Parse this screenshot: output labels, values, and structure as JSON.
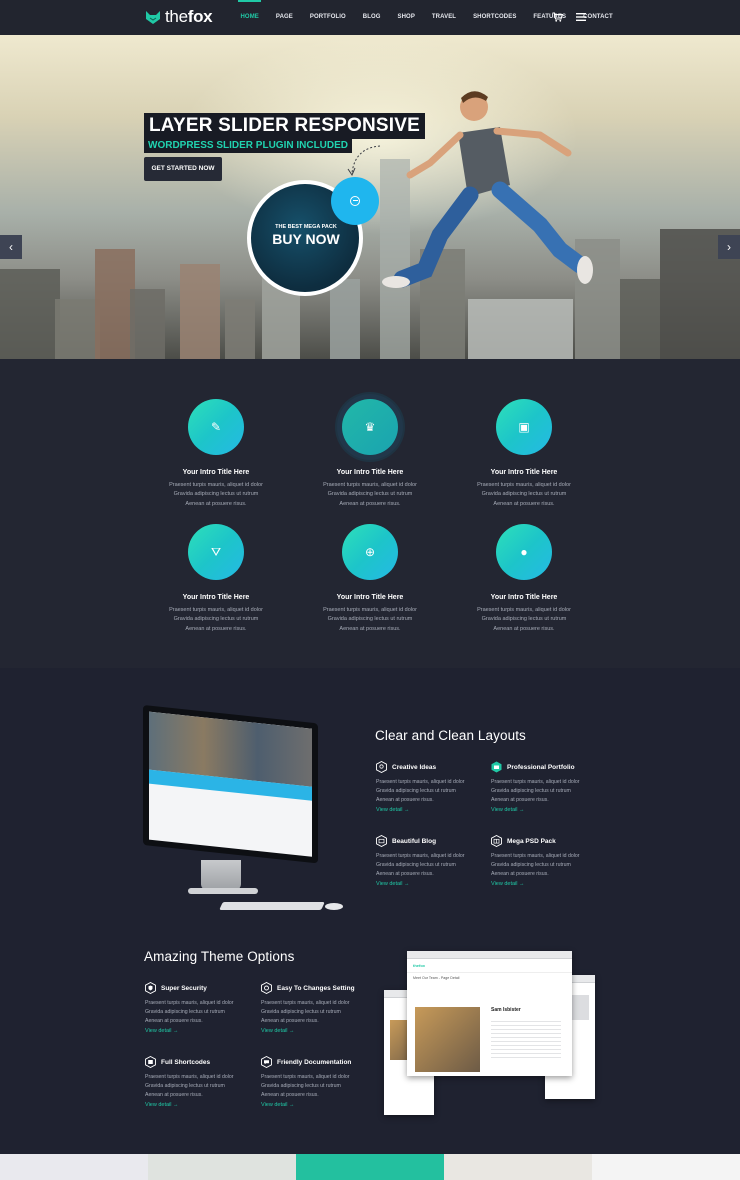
{
  "nav": {
    "brand_prefix": "the",
    "brand_name": "fox",
    "items": [
      {
        "label": "HOME",
        "active": true
      },
      {
        "label": "PAGE"
      },
      {
        "label": "PORTFOLIO"
      },
      {
        "label": "BLOG"
      },
      {
        "label": "SHOP"
      },
      {
        "label": "TRAVEL"
      },
      {
        "label": "SHORTCODES"
      },
      {
        "label": "FEATURES"
      },
      {
        "label": "CONTACT"
      }
    ],
    "icons": [
      "cart-icon",
      "hamburger-menu-icon"
    ],
    "accent_color": "#20c9a6"
  },
  "hero": {
    "title": "LAYER SLIDER RESPONSIVE",
    "subtitle": "WORDPRESS SLIDER PLUGIN INCLUDED",
    "cta_label": "GET STARTED NOW",
    "badge_small": "THE BEST MEGA PACK",
    "badge_big": "BUY NOW",
    "prev_arrow": "‹",
    "next_arrow": "›",
    "slide_count": 4,
    "active_slide": 3
  },
  "features": [
    {
      "icon": "pencil-ruler-icon",
      "title": "Your Intro Title Here",
      "line1": "Praesent turpis mauris, aliquet id dolor",
      "line2": "Gravida adipiscing lectus ut rutrum",
      "line3": "Aenean at posuere risus."
    },
    {
      "icon": "crown-icon",
      "title": "Your Intro Title Here",
      "line1": "Praesent turpis mauris, aliquet id dolor",
      "line2": "Gravida adipiscing lectus ut rutrum",
      "line3": "Aenean at posuere risus."
    },
    {
      "icon": "archive-box-icon",
      "title": "Your Intro Title Here",
      "line1": "Praesent turpis mauris, aliquet id dolor",
      "line2": "Gravida adipiscing lectus ut rutrum",
      "line3": "Aenean at posuere risus."
    },
    {
      "icon": "basket-icon",
      "title": "Your Intro Title Here",
      "line1": "Praesent turpis mauris, aliquet id dolor",
      "line2": "Gravida adipiscing lectus ut rutrum",
      "line3": "Aenean at posuere risus."
    },
    {
      "icon": "lifebuoy-icon",
      "title": "Your Intro Title Here",
      "line1": "Praesent turpis mauris, aliquet id dolor",
      "line2": "Gravida adipiscing lectus ut rutrum",
      "line3": "Aenean at posuere risus."
    },
    {
      "icon": "bomb-icon",
      "title": "Your Intro Title Here",
      "line1": "Praesent turpis mauris, aliquet id dolor",
      "line2": "Gravida adipiscing lectus ut rutrum",
      "line3": "Aenean at posuere risus."
    }
  ],
  "layouts": {
    "title": "Clear and Clean Layouts",
    "items": [
      {
        "icon": "bulb-icon",
        "title": "Creative Ideas",
        "line1": "Praesent turpis mauris, aliquet id dolor",
        "line2": "Gravida adipiscing lectus ut rutrum",
        "line3": "Aenean at posuere risus.",
        "link": "View detail  →"
      },
      {
        "icon": "briefcase-icon",
        "title": "Professional Portfolio",
        "line1": "Praesent turpis mauris, aliquet id dolor",
        "line2": "Gravida adipiscing lectus ut rutrum",
        "line3": "Aenean at posuere risus.",
        "link": "View detail  →"
      },
      {
        "icon": "image-icon",
        "title": "Beautiful Blog",
        "line1": "Praesent turpis mauris, aliquet id dolor",
        "line2": "Gravida adipiscing lectus ut rutrum",
        "line3": "Aenean at posuere risus.",
        "link": "View detail  →"
      },
      {
        "icon": "gift-icon",
        "title": "Mega PSD Pack",
        "line1": "Praesent turpis mauris, aliquet id dolor",
        "line2": "Gravida adipiscing lectus ut rutrum",
        "line3": "Aenean at posuere risus.",
        "link": "View detail  →"
      }
    ]
  },
  "options": {
    "title": "Amazing Theme Options",
    "items": [
      {
        "icon": "shield-icon",
        "title": "Super Security",
        "line1": "Praesent turpis mauris, aliquet id dolor",
        "line2": "Gravida adipiscing lectus ut rutrum",
        "line3": "Aenean at posuere risus.",
        "link": "View detail  →"
      },
      {
        "icon": "gear-icon",
        "title": "Easy To Changes Setting",
        "line1": "Praesent turpis mauris, aliquet id dolor",
        "line2": "Gravida adipiscing lectus ut rutrum",
        "line3": "Aenean at posuere risus.",
        "link": "View detail  →"
      },
      {
        "icon": "code-icon",
        "title": "Full Shortcodes",
        "line1": "Praesent turpis mauris, aliquet id dolor",
        "line2": "Gravida adipiscing lectus ut rutrum",
        "line3": "Aenean at posuere risus.",
        "link": "View detail  →"
      },
      {
        "icon": "chat-icon",
        "title": "Friendly Documentation",
        "line1": "Praesent turpis mauris, aliquet id dolor",
        "line2": "Gravida adipiscing lectus ut rutrum",
        "line3": "Aenean at posuere risus.",
        "link": "View detail  →"
      }
    ]
  },
  "mockup": {
    "brand": "thefox",
    "page_label": "Meet Our Team - Page Detail",
    "person_name": "Sam Isbister"
  }
}
